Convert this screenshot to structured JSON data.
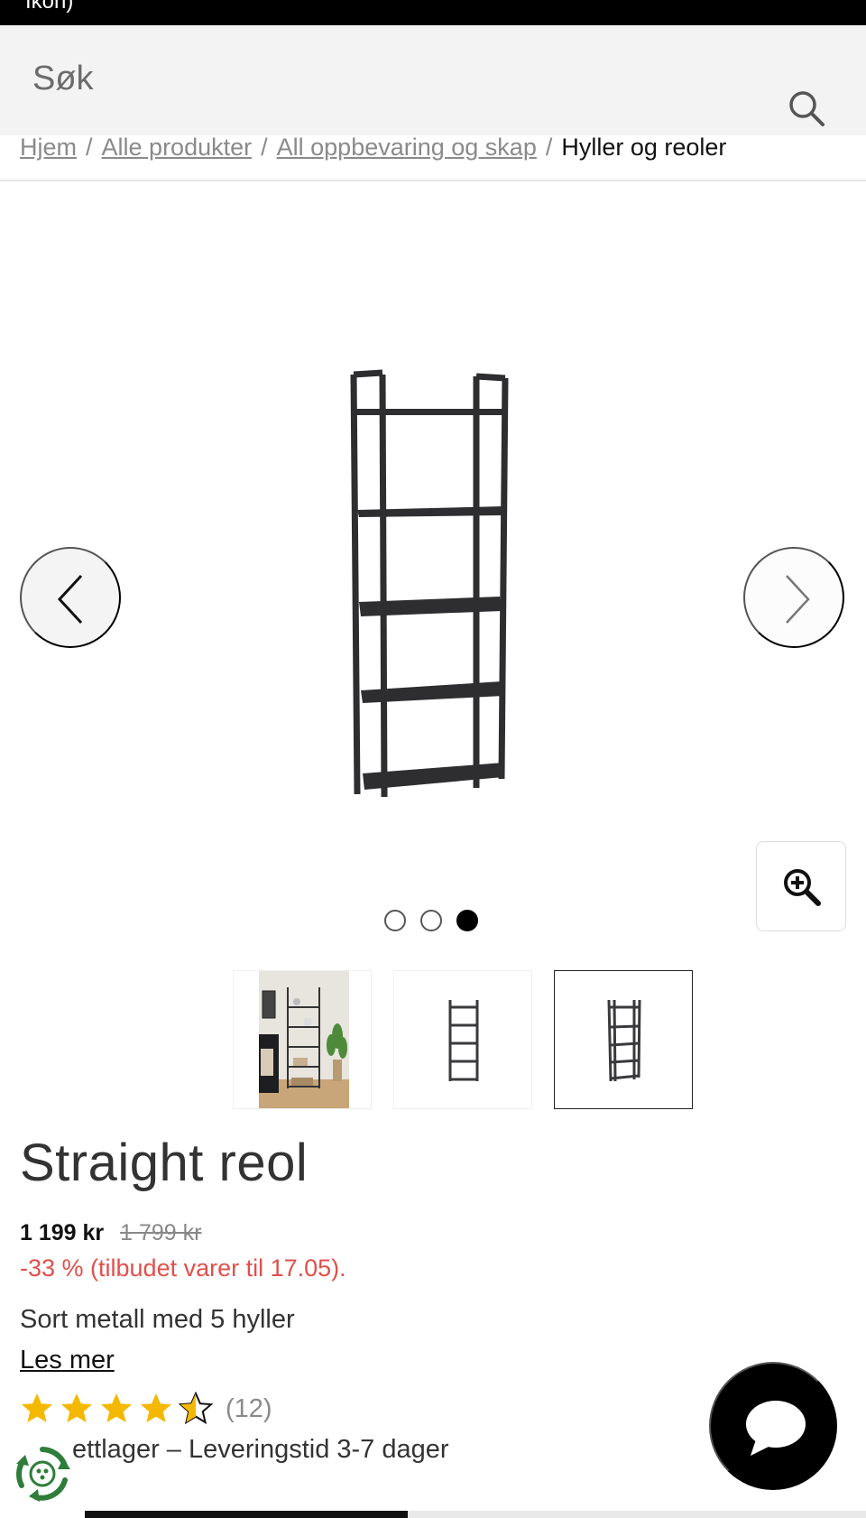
{
  "status_bar": {
    "text": "Ikon)"
  },
  "search": {
    "placeholder": "Søk",
    "icon": "search-icon"
  },
  "breadcrumb": {
    "items": [
      "Hjem",
      "Alle produkter",
      "All oppbevaring og skap"
    ],
    "separator": "/",
    "current": "Hyller og reoler"
  },
  "gallery": {
    "prev_icon": "chevron-left-icon",
    "next_icon": "chevron-right-icon",
    "zoom_icon": "zoom-in-icon",
    "slide_count": 3,
    "active_slide": 3,
    "thumbnails": [
      "thumbnail-room-scene",
      "thumbnail-shelf-front",
      "thumbnail-shelf-angle"
    ],
    "active_thumbnail": 3
  },
  "product": {
    "title": "Straight reol",
    "price_current": "1 199 kr",
    "price_old": "1 799 kr",
    "discount": "-33 % (tilbudet varer til 17.05).",
    "description": "Sort metall med 5 hyller",
    "read_more": "Les mer",
    "rating": 4.5,
    "rating_max": 5,
    "review_count": "(12)",
    "stock": "ettlager – Leveringstid 3-7 dager"
  },
  "colors": {
    "accent_star": "#f5b800",
    "discount_red": "#e0504c",
    "chat_button": "#000000",
    "eco_green": "#2f7d3a"
  },
  "chat": {
    "icon": "chat-bubble-icon"
  },
  "page_progress": 0.41
}
